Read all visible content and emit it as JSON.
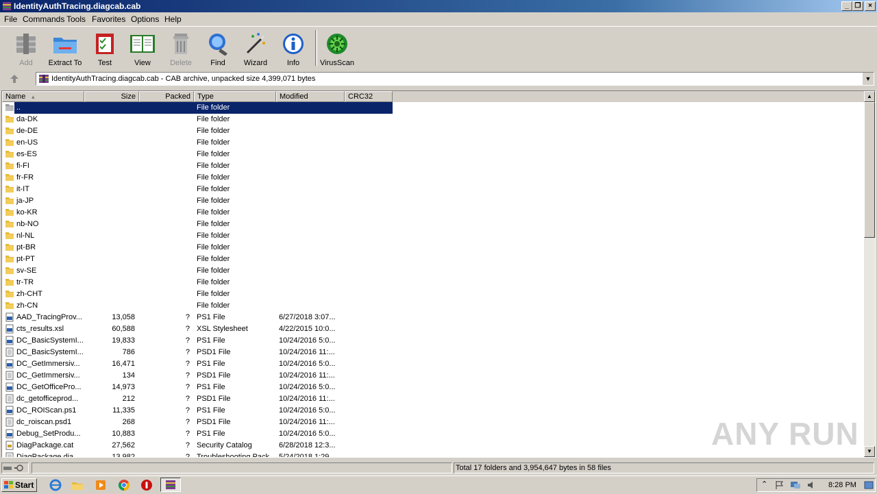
{
  "window": {
    "title": "IdentityAuthTracing.diagcab.cab"
  },
  "menu": [
    "File",
    "Commands",
    "Tools",
    "Favorites",
    "Options",
    "Help"
  ],
  "toolbar": [
    {
      "label": "Add",
      "icon": "add-archive-icon",
      "enabled": false
    },
    {
      "label": "Extract To",
      "icon": "extract-folder-icon",
      "enabled": true
    },
    {
      "label": "Test",
      "icon": "test-checklist-icon",
      "enabled": true
    },
    {
      "label": "View",
      "icon": "view-book-icon",
      "enabled": true
    },
    {
      "label": "Delete",
      "icon": "trash-icon",
      "enabled": false
    },
    {
      "label": "Find",
      "icon": "magnifier-icon",
      "enabled": true
    },
    {
      "label": "Wizard",
      "icon": "magic-wand-icon",
      "enabled": true
    },
    {
      "label": "Info",
      "icon": "info-icon",
      "enabled": true
    },
    {
      "label": "VirusScan",
      "icon": "virus-scan-icon",
      "enabled": true
    }
  ],
  "address": {
    "text": "IdentityAuthTracing.diagcab.cab - CAB archive, unpacked size 4,399,071 bytes"
  },
  "columns": {
    "name": "Name",
    "size": "Size",
    "packed": "Packed",
    "type": "Type",
    "modified": "Modified",
    "crc": "CRC32"
  },
  "rows": [
    {
      "name": "..",
      "size": "",
      "packed": "",
      "type": "File folder",
      "modified": "",
      "crc": "",
      "icon": "parent-folder-icon"
    },
    {
      "name": "da-DK",
      "size": "",
      "packed": "",
      "type": "File folder",
      "modified": "",
      "crc": "",
      "icon": "folder-icon"
    },
    {
      "name": "de-DE",
      "size": "",
      "packed": "",
      "type": "File folder",
      "modified": "",
      "crc": "",
      "icon": "folder-icon"
    },
    {
      "name": "en-US",
      "size": "",
      "packed": "",
      "type": "File folder",
      "modified": "",
      "crc": "",
      "icon": "folder-icon"
    },
    {
      "name": "es-ES",
      "size": "",
      "packed": "",
      "type": "File folder",
      "modified": "",
      "crc": "",
      "icon": "folder-icon"
    },
    {
      "name": "fi-FI",
      "size": "",
      "packed": "",
      "type": "File folder",
      "modified": "",
      "crc": "",
      "icon": "folder-icon"
    },
    {
      "name": "fr-FR",
      "size": "",
      "packed": "",
      "type": "File folder",
      "modified": "",
      "crc": "",
      "icon": "folder-icon"
    },
    {
      "name": "it-IT",
      "size": "",
      "packed": "",
      "type": "File folder",
      "modified": "",
      "crc": "",
      "icon": "folder-icon"
    },
    {
      "name": "ja-JP",
      "size": "",
      "packed": "",
      "type": "File folder",
      "modified": "",
      "crc": "",
      "icon": "folder-icon"
    },
    {
      "name": "ko-KR",
      "size": "",
      "packed": "",
      "type": "File folder",
      "modified": "",
      "crc": "",
      "icon": "folder-icon"
    },
    {
      "name": "nb-NO",
      "size": "",
      "packed": "",
      "type": "File folder",
      "modified": "",
      "crc": "",
      "icon": "folder-icon"
    },
    {
      "name": "nl-NL",
      "size": "",
      "packed": "",
      "type": "File folder",
      "modified": "",
      "crc": "",
      "icon": "folder-icon"
    },
    {
      "name": "pt-BR",
      "size": "",
      "packed": "",
      "type": "File folder",
      "modified": "",
      "crc": "",
      "icon": "folder-icon"
    },
    {
      "name": "pt-PT",
      "size": "",
      "packed": "",
      "type": "File folder",
      "modified": "",
      "crc": "",
      "icon": "folder-icon"
    },
    {
      "name": "sv-SE",
      "size": "",
      "packed": "",
      "type": "File folder",
      "modified": "",
      "crc": "",
      "icon": "folder-icon"
    },
    {
      "name": "tr-TR",
      "size": "",
      "packed": "",
      "type": "File folder",
      "modified": "",
      "crc": "",
      "icon": "folder-icon"
    },
    {
      "name": "zh-CHT",
      "size": "",
      "packed": "",
      "type": "File folder",
      "modified": "",
      "crc": "",
      "icon": "folder-icon"
    },
    {
      "name": "zh-CN",
      "size": "",
      "packed": "",
      "type": "File folder",
      "modified": "",
      "crc": "",
      "icon": "folder-icon"
    },
    {
      "name": "AAD_TracingProv...",
      "size": "13,058",
      "packed": "?",
      "type": "PS1 File",
      "modified": "6/27/2018 3:07...",
      "crc": "",
      "icon": "ps1-file-icon"
    },
    {
      "name": "cts_results.xsl",
      "size": "60,588",
      "packed": "?",
      "type": "XSL Stylesheet",
      "modified": "4/22/2015 10:0...",
      "crc": "",
      "icon": "xsl-file-icon"
    },
    {
      "name": "DC_BasicSystemI...",
      "size": "19,833",
      "packed": "?",
      "type": "PS1 File",
      "modified": "10/24/2016 5:0...",
      "crc": "",
      "icon": "ps1-file-icon"
    },
    {
      "name": "DC_BasicSystemI...",
      "size": "786",
      "packed": "?",
      "type": "PSD1 File",
      "modified": "10/24/2016 11:...",
      "crc": "",
      "icon": "psd1-file-icon"
    },
    {
      "name": "DC_GetImmersiv...",
      "size": "16,471",
      "packed": "?",
      "type": "PS1 File",
      "modified": "10/24/2016 5:0...",
      "crc": "",
      "icon": "ps1-file-icon"
    },
    {
      "name": "DC_GetImmersiv...",
      "size": "134",
      "packed": "?",
      "type": "PSD1 File",
      "modified": "10/24/2016 11:...",
      "crc": "",
      "icon": "psd1-file-icon"
    },
    {
      "name": "DC_GetOfficePro...",
      "size": "14,973",
      "packed": "?",
      "type": "PS1 File",
      "modified": "10/24/2016 5:0...",
      "crc": "",
      "icon": "ps1-file-icon"
    },
    {
      "name": "dc_getofficeprod...",
      "size": "212",
      "packed": "?",
      "type": "PSD1 File",
      "modified": "10/24/2016 11:...",
      "crc": "",
      "icon": "psd1-file-icon"
    },
    {
      "name": "DC_ROIScan.ps1",
      "size": "11,335",
      "packed": "?",
      "type": "PS1 File",
      "modified": "10/24/2016 5:0...",
      "crc": "",
      "icon": "ps1-file-icon"
    },
    {
      "name": "dc_roiscan.psd1",
      "size": "268",
      "packed": "?",
      "type": "PSD1 File",
      "modified": "10/24/2016 11:...",
      "crc": "",
      "icon": "psd1-file-icon"
    },
    {
      "name": "Debug_SetProdu...",
      "size": "10,883",
      "packed": "?",
      "type": "PS1 File",
      "modified": "10/24/2016 5:0...",
      "crc": "",
      "icon": "ps1-file-icon"
    },
    {
      "name": "DiagPackage.cat",
      "size": "27,562",
      "packed": "?",
      "type": "Security Catalog",
      "modified": "6/28/2018 12:3...",
      "crc": "",
      "icon": "catalog-file-icon"
    },
    {
      "name": "DiagPackage.dia...",
      "size": "13,982",
      "packed": "?",
      "type": "Troubleshooting Pack",
      "modified": "5/24/2018 1:29...",
      "crc": "",
      "icon": "diag-file-icon"
    }
  ],
  "selected_row": 0,
  "status": {
    "text": "Total 17 folders and 3,954,647 bytes in 58 files"
  },
  "taskbar": {
    "start_label": "Start",
    "clock": "8:28 PM"
  },
  "watermark": "ANY RUN",
  "colors": {
    "selection": "#0a246a",
    "title_start": "#0a246a",
    "title_end": "#a6caf0",
    "face": "#d4d0c8",
    "folder": "#e8b93a"
  }
}
